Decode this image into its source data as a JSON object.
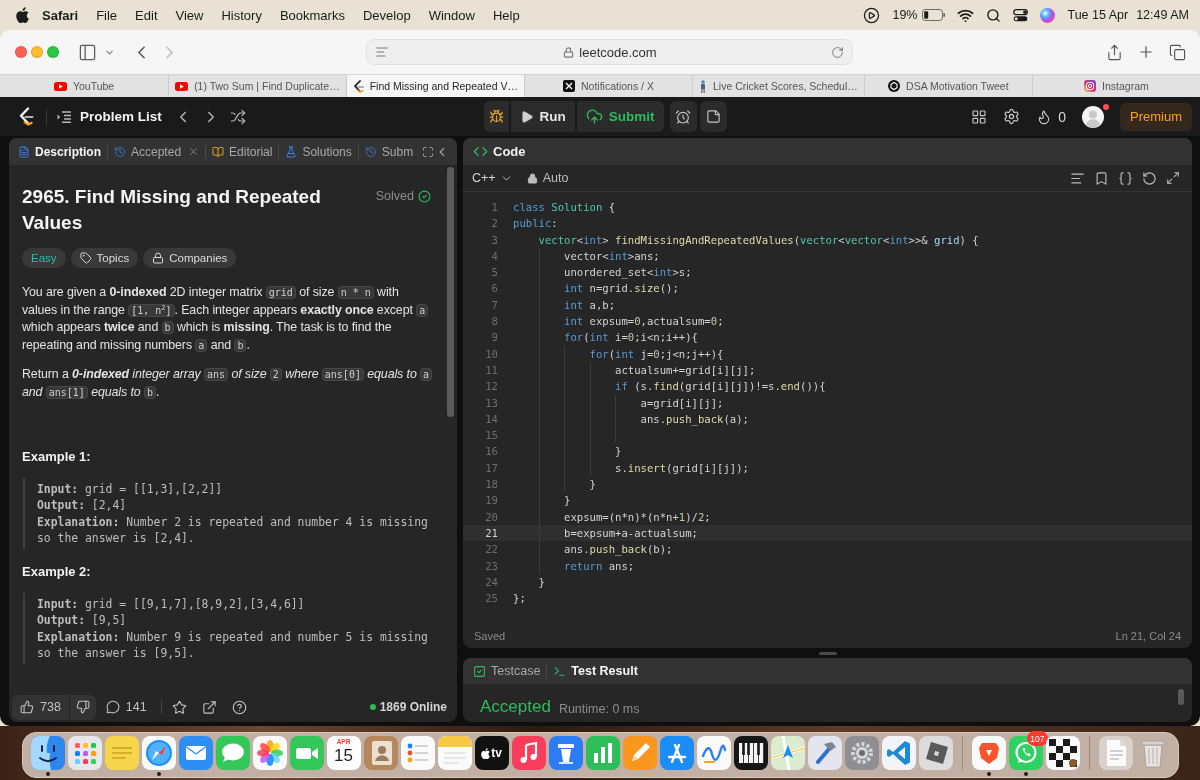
{
  "menu_bar": {
    "items": [
      {
        "label": "Safari",
        "kind": "app"
      },
      {
        "label": "File",
        "kind": "menu"
      },
      {
        "label": "Edit",
        "kind": "menu"
      },
      {
        "label": "View",
        "kind": "menu"
      },
      {
        "label": "History",
        "kind": "menu"
      },
      {
        "label": "Bookmarks",
        "kind": "menu"
      },
      {
        "label": "Develop",
        "kind": "menu"
      },
      {
        "label": "Window",
        "kind": "menu"
      },
      {
        "label": "Help",
        "kind": "menu"
      }
    ],
    "battery": "19%",
    "date": "Tue 15 Apr",
    "time": "12:49 AM"
  },
  "browser": {
    "address": "leetcode.com",
    "tabs": [
      {
        "title": "YouTube",
        "kind": "video",
        "selected": false
      },
      {
        "title": "(1) Two Sum | Find Duplicate…",
        "kind": "video",
        "selected": false
      },
      {
        "title": "Find Missing and Repeated V…",
        "kind": "logo",
        "selected": true
      },
      {
        "title": "Notifications / X",
        "kind": "x",
        "selected": false
      },
      {
        "title": "Live Cricket Scores, Schedul…",
        "kind": "figure",
        "selected": false
      },
      {
        "title": "DSA Motivation Tweet",
        "kind": "knot",
        "selected": false
      },
      {
        "title": "Instagram",
        "kind": "camera",
        "selected": false
      }
    ]
  },
  "nav": {
    "problem_list": "Problem List",
    "run": "Run",
    "submit": "Submit",
    "streak": "0",
    "notification": true,
    "premium": "Premium"
  },
  "description_panel": {
    "tabs": [
      {
        "label": "Description",
        "kind": "document",
        "selected": true,
        "closable": false
      },
      {
        "label": "Accepted",
        "kind": "history",
        "selected": false,
        "closable": true
      },
      {
        "label": "Editorial",
        "kind": "book",
        "selected": false,
        "closable": false
      },
      {
        "label": "Solutions",
        "kind": "flask",
        "selected": false,
        "closable": false
      },
      {
        "label": "Subm",
        "kind": "history",
        "selected": false,
        "closable": false
      }
    ],
    "title": "2965. Find Missing and Repeated Values",
    "status": "Solved",
    "tags": [
      {
        "label": "Easy",
        "kind": "difficulty"
      },
      {
        "label": "Topics",
        "kind": "topics"
      },
      {
        "label": "Companies",
        "kind": "companies"
      }
    ],
    "paragraphs": [
      [
        {
          "kind": "text",
          "text": "You are given a **0-indexed** 2D integer matrix ",
          "italic": false
        },
        {
          "kind": "code",
          "text": "grid"
        },
        {
          "kind": "text",
          "text": " of size ",
          "italic": false
        },
        {
          "kind": "code",
          "text": "n * n"
        },
        {
          "kind": "text",
          "text": " with values in the range ",
          "italic": false
        },
        {
          "kind": "code",
          "text": "[1, n$^{2}$]"
        },
        {
          "kind": "text",
          "text": ". Each integer appears **exactly once** except ",
          "italic": false
        },
        {
          "kind": "code",
          "text": "a"
        },
        {
          "kind": "text",
          "text": " which appears **twice** and ",
          "italic": false
        },
        {
          "kind": "code",
          "text": "b"
        },
        {
          "kind": "text",
          "text": " which is **missing**. The task is to find the repeating and missing numbers ",
          "italic": false
        },
        {
          "kind": "code",
          "text": "a"
        },
        {
          "kind": "text",
          "text": " and ",
          "italic": false
        },
        {
          "kind": "code",
          "text": "b"
        },
        {
          "kind": "text",
          "text": ".",
          "italic": false
        }
      ],
      [
        {
          "kind": "text",
          "text": "Return a ",
          "italic": false
        },
        {
          "kind": "text",
          "text": "**0-indexed** integer array ",
          "italic": true
        },
        {
          "kind": "code",
          "text": "ans"
        },
        {
          "kind": "text",
          "text": " of size ",
          "italic": true
        },
        {
          "kind": "code",
          "text": "2"
        },
        {
          "kind": "text",
          "text": " where ",
          "italic": true
        },
        {
          "kind": "code",
          "text": "ans[0]"
        },
        {
          "kind": "text",
          "text": " equals to ",
          "italic": true
        },
        {
          "kind": "code",
          "text": "a"
        },
        {
          "kind": "text",
          "text": " and ",
          "italic": true
        },
        {
          "kind": "code",
          "text": "ans[1]"
        },
        {
          "kind": "text",
          "text": " equals to ",
          "italic": true
        },
        {
          "kind": "code",
          "text": "b"
        },
        {
          "kind": "text",
          "text": ".",
          "italic": false
        }
      ]
    ],
    "examples": [
      {
        "heading": "Example 1:",
        "lines": [
          "**Input:** grid = [[1,3],[2,2]]",
          "**Output:** [2,4]",
          "**Explanation:** Number 2 is repeated and number 4 is missing so the answer is [2,4]."
        ]
      },
      {
        "heading": "Example 2:",
        "lines": [
          "**Input:** grid = [[9,1,7],[8,9,2],[3,4,6]]",
          "**Output:** [9,5]",
          "**Explanation:** Number 9 is repeated and number 5 is missing so the answer is [9,5]."
        ]
      }
    ],
    "footer": {
      "likes": "738",
      "comments": "141",
      "online": "1869 Online"
    }
  },
  "code_panel": {
    "title": "Code",
    "language": "C++",
    "mode": "Auto",
    "lines": [
      {
        "number": "1",
        "current": false,
        "tokens": [
          {
            "text": "class ",
            "kind": "keyword"
          },
          {
            "text": "Solution",
            "kind": "type"
          },
          {
            "text": " {",
            "kind": "plain"
          }
        ]
      },
      {
        "number": "2",
        "current": false,
        "tokens": [
          {
            "text": "public",
            "kind": "keyword"
          },
          {
            "text": ":",
            "kind": "plain"
          }
        ],
        "children": [
          {
            "number": "3",
            "current": false,
            "tokens": [
              {
                "text": "vector",
                "kind": "type"
              },
              {
                "text": "<",
                "kind": "plain"
              },
              {
                "text": "int",
                "kind": "keyword"
              },
              {
                "text": "> ",
                "kind": "plain"
              },
              {
                "text": "findMissingAndRepeatedValues",
                "kind": "function"
              },
              {
                "text": "(",
                "kind": "plain"
              },
              {
                "text": "vector",
                "kind": "type"
              },
              {
                "text": "<",
                "kind": "plain"
              },
              {
                "text": "vector",
                "kind": "type"
              },
              {
                "text": "<",
                "kind": "plain"
              },
              {
                "text": "int",
                "kind": "keyword"
              },
              {
                "text": ">>& ",
                "kind": "plain"
              },
              {
                "text": "grid",
                "kind": "variable"
              },
              {
                "text": ") {",
                "kind": "plain"
              }
            ],
            "children": [
              {
                "number": "4",
                "current": false,
                "tokens": [
                  {
                    "text": "vector<",
                    "kind": "plain"
                  },
                  {
                    "text": "int",
                    "kind": "keyword"
                  },
                  {
                    "text": ">ans;",
                    "kind": "plain"
                  }
                ]
              },
              {
                "number": "5",
                "current": false,
                "tokens": [
                  {
                    "text": "unordered_set<",
                    "kind": "plain"
                  },
                  {
                    "text": "int",
                    "kind": "keyword"
                  },
                  {
                    "text": ">s;",
                    "kind": "plain"
                  }
                ]
              },
              {
                "number": "6",
                "current": false,
                "tokens": [
                  {
                    "text": "int",
                    "kind": "keyword"
                  },
                  {
                    "text": " n=grid.",
                    "kind": "plain"
                  },
                  {
                    "text": "size",
                    "kind": "function"
                  },
                  {
                    "text": "();",
                    "kind": "plain"
                  }
                ]
              },
              {
                "number": "7",
                "current": false,
                "tokens": [
                  {
                    "text": "int",
                    "kind": "keyword"
                  },
                  {
                    "text": " a,b;",
                    "kind": "plain"
                  }
                ]
              },
              {
                "number": "8",
                "current": false,
                "tokens": [
                  {
                    "text": "int",
                    "kind": "keyword"
                  },
                  {
                    "text": " expsum=",
                    "kind": "plain"
                  },
                  {
                    "text": "0",
                    "kind": "number"
                  },
                  {
                    "text": ",actualsum=",
                    "kind": "plain"
                  },
                  {
                    "text": "0",
                    "kind": "number"
                  },
                  {
                    "text": ";",
                    "kind": "plain"
                  }
                ]
              },
              {
                "number": "9",
                "current": false,
                "tokens": [
                  {
                    "text": "for",
                    "kind": "keyword"
                  },
                  {
                    "text": "(",
                    "kind": "plain"
                  },
                  {
                    "text": "int",
                    "kind": "keyword"
                  },
                  {
                    "text": " i=",
                    "kind": "plain"
                  },
                  {
                    "text": "0",
                    "kind": "number"
                  },
                  {
                    "text": ";i<n;i++){",
                    "kind": "plain"
                  }
                ],
                "children": [
                  {
                    "number": "10",
                    "current": false,
                    "tokens": [
                      {
                        "text": "for",
                        "kind": "keyword"
                      },
                      {
                        "text": "(",
                        "kind": "plain"
                      },
                      {
                        "text": "int",
                        "kind": "keyword"
                      },
                      {
                        "text": " j=",
                        "kind": "plain"
                      },
                      {
                        "text": "0",
                        "kind": "number"
                      },
                      {
                        "text": ";j<n;j++){",
                        "kind": "plain"
                      }
                    ],
                    "children": [
                      {
                        "number": "11",
                        "current": false,
                        "tokens": [
                          {
                            "text": "actualsum+=grid[i][j];",
                            "kind": "plain"
                          }
                        ]
                      },
                      {
                        "number": "12",
                        "current": false,
                        "tokens": [
                          {
                            "text": "if",
                            "kind": "keyword"
                          },
                          {
                            "text": " (s.",
                            "kind": "plain"
                          },
                          {
                            "text": "find",
                            "kind": "function"
                          },
                          {
                            "text": "(grid[i][j])!=s.",
                            "kind": "plain"
                          },
                          {
                            "text": "end",
                            "kind": "function"
                          },
                          {
                            "text": "()){",
                            "kind": "plain"
                          }
                        ],
                        "children": [
                          {
                            "number": "13",
                            "current": false,
                            "tokens": [
                              {
                                "text": "a=grid[i][j];",
                                "kind": "plain"
                              }
                            ]
                          },
                          {
                            "number": "14",
                            "current": false,
                            "tokens": [
                              {
                                "text": "ans.",
                                "kind": "plain"
                              },
                              {
                                "text": "push_back",
                                "kind": "function"
                              },
                              {
                                "text": "(a);",
                                "kind": "plain"
                              }
                            ]
                          },
                          {
                            "number": "15",
                            "current": false
                          }
                        ]
                      },
                      {
                        "number": "16",
                        "current": false,
                        "tokens": [
                          {
                            "text": "}",
                            "kind": "plain"
                          }
                        ]
                      },
                      {
                        "number": "17",
                        "current": false,
                        "tokens": [
                          {
                            "text": "s.",
                            "kind": "plain"
                          },
                          {
                            "text": "insert",
                            "kind": "function"
                          },
                          {
                            "text": "(grid[i][j]);",
                            "kind": "plain"
                          }
                        ]
                      }
                    ]
                  },
                  {
                    "number": "18",
                    "current": false,
                    "tokens": [
                      {
                        "text": "}",
                        "kind": "plain"
                      }
                    ]
                  }
                ]
              },
              {
                "number": "19",
                "current": false,
                "tokens": [
                  {
                    "text": "}",
                    "kind": "plain"
                  }
                ]
              },
              {
                "number": "20",
                "current": false,
                "tokens": [
                  {
                    "text": "expsum=(n*n)*(n*n+",
                    "kind": "plain"
                  },
                  {
                    "text": "1",
                    "kind": "number"
                  },
                  {
                    "text": ")/",
                    "kind": "plain"
                  },
                  {
                    "text": "2",
                    "kind": "number"
                  },
                  {
                    "text": ";",
                    "kind": "plain"
                  }
                ]
              },
              {
                "number": "21",
                "current": true,
                "tokens": [
                  {
                    "text": "b=expsum+a-actualsum;",
                    "kind": "plain"
                  }
                ]
              },
              {
                "number": "22",
                "current": false,
                "tokens": [
                  {
                    "text": "ans.",
                    "kind": "plain"
                  },
                  {
                    "text": "push_back",
                    "kind": "function"
                  },
                  {
                    "text": "(b);",
                    "kind": "plain"
                  }
                ]
              },
              {
                "number": "23",
                "current": false,
                "tokens": [
                  {
                    "text": "return",
                    "kind": "keyword"
                  },
                  {
                    "text": " ans;",
                    "kind": "plain"
                  }
                ]
              }
            ]
          },
          {
            "number": "24",
            "current": false,
            "tokens": [
              {
                "text": "}",
                "kind": "plain"
              }
            ]
          }
        ]
      },
      {
        "number": "25",
        "current": false,
        "tokens": [
          {
            "text": "};",
            "kind": "plain"
          }
        ]
      }
    ],
    "status": "Saved",
    "cursor": "Ln 21, Col 24"
  },
  "test_panel": {
    "tabs": [
      {
        "label": "Testcase",
        "kind": "checkbox",
        "selected": false
      },
      {
        "label": "Test Result",
        "kind": "terminal",
        "selected": true
      }
    ],
    "verdict": "Accepted",
    "runtime": "Runtime: 0 ms"
  },
  "dock": {
    "sections": [
      {
        "items": [
          {
            "kind": "face",
            "running": true
          },
          {
            "kind": "grid",
            "running": false
          },
          {
            "kind": "notepad",
            "running": false
          },
          {
            "kind": "compass",
            "running": true
          },
          {
            "kind": "envelope",
            "running": false
          },
          {
            "kind": "bubble",
            "running": false
          },
          {
            "kind": "flower",
            "running": false
          },
          {
            "kind": "camera",
            "running": false
          },
          {
            "kind": "calendar",
            "running": false,
            "month": "APR",
            "day": "15"
          },
          {
            "kind": "contact",
            "running": false
          },
          {
            "kind": "checklist",
            "running": false
          },
          {
            "kind": "memo",
            "running": false
          },
          {
            "kind": "tv",
            "running": false,
            "label": "tv"
          },
          {
            "kind": "music",
            "running": false
          },
          {
            "kind": "podium",
            "running": false
          },
          {
            "kind": "chart",
            "running": false
          },
          {
            "kind": "pencil",
            "running": false
          },
          {
            "kind": "appstore",
            "running": false
          },
          {
            "kind": "squiggle",
            "running": false
          },
          {
            "kind": "piano",
            "running": false
          },
          {
            "kind": "map",
            "running": false
          },
          {
            "kind": "hammer",
            "running": false
          },
          {
            "kind": "gear",
            "running": false
          },
          {
            "kind": "code",
            "running": false
          },
          {
            "kind": "cube",
            "running": false
          }
        ]
      },
      {
        "items": [
          {
            "kind": "lion",
            "running": true
          },
          {
            "kind": "phone",
            "running": true,
            "badge": "107"
          },
          {
            "kind": "checker",
            "running": false
          }
        ]
      },
      {
        "items": [
          {
            "kind": "document",
            "running": false
          },
          {
            "kind": "trash",
            "running": false
          }
        ]
      }
    ]
  }
}
